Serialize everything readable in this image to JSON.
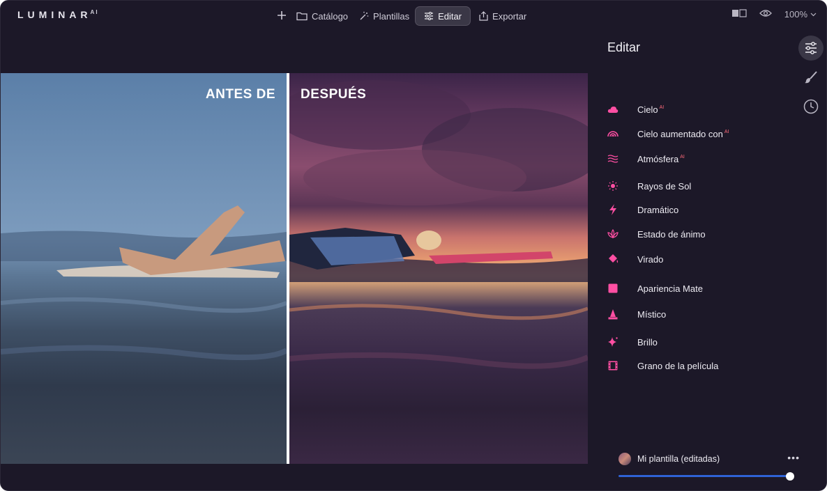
{
  "app": {
    "logo_text": "LUMINAR",
    "logo_suffix": "AI"
  },
  "nav": {
    "add_icon": "plus-icon",
    "catalog_label": "Catálogo",
    "templates_label": "Plantillas",
    "edit_label": "Editar",
    "export_label": "Exportar"
  },
  "view": {
    "compare_icon": "compare-icon",
    "preview_icon": "eye-icon",
    "zoom_value": "100%"
  },
  "image": {
    "before_label": "ANTES DE",
    "after_label": "DESPUÉS"
  },
  "panel": {
    "title": "Editar",
    "side_tools": [
      "sliders-icon",
      "brush-icon",
      "clock-icon"
    ],
    "ai_badge": "AI",
    "tools": [
      {
        "label": "Cielo",
        "ai": true,
        "icon": "cloud-icon"
      },
      {
        "label": "Cielo aumentado con",
        "ai": true,
        "icon": "rainbow-icon"
      },
      {
        "label": "Atmósfera",
        "ai": true,
        "icon": "waves-icon"
      },
      {
        "label": "Rayos de Sol",
        "ai": false,
        "icon": "sun-icon"
      },
      {
        "label": "Dramático",
        "ai": false,
        "icon": "bolt-icon"
      },
      {
        "label": "Estado de ánimo",
        "ai": false,
        "icon": "lotus-icon"
      },
      {
        "label": "Virado",
        "ai": false,
        "icon": "paint-bucket-icon"
      },
      {
        "label": "Apariencia Mate",
        "ai": false,
        "icon": "square-icon"
      },
      {
        "label": "Místico",
        "ai": false,
        "icon": "cone-icon"
      },
      {
        "label": "Brillo",
        "ai": false,
        "icon": "sparkle-icon"
      },
      {
        "label": "Grano de la película",
        "ai": false,
        "icon": "film-icon"
      }
    ],
    "template_name": "Mi plantilla (editadas)",
    "template_more": "•••",
    "template_amount": 1.0
  },
  "colors": {
    "accent_pink": "#ff4fa3",
    "slider_blue": "#2f62d6",
    "background": "#1c1828"
  }
}
